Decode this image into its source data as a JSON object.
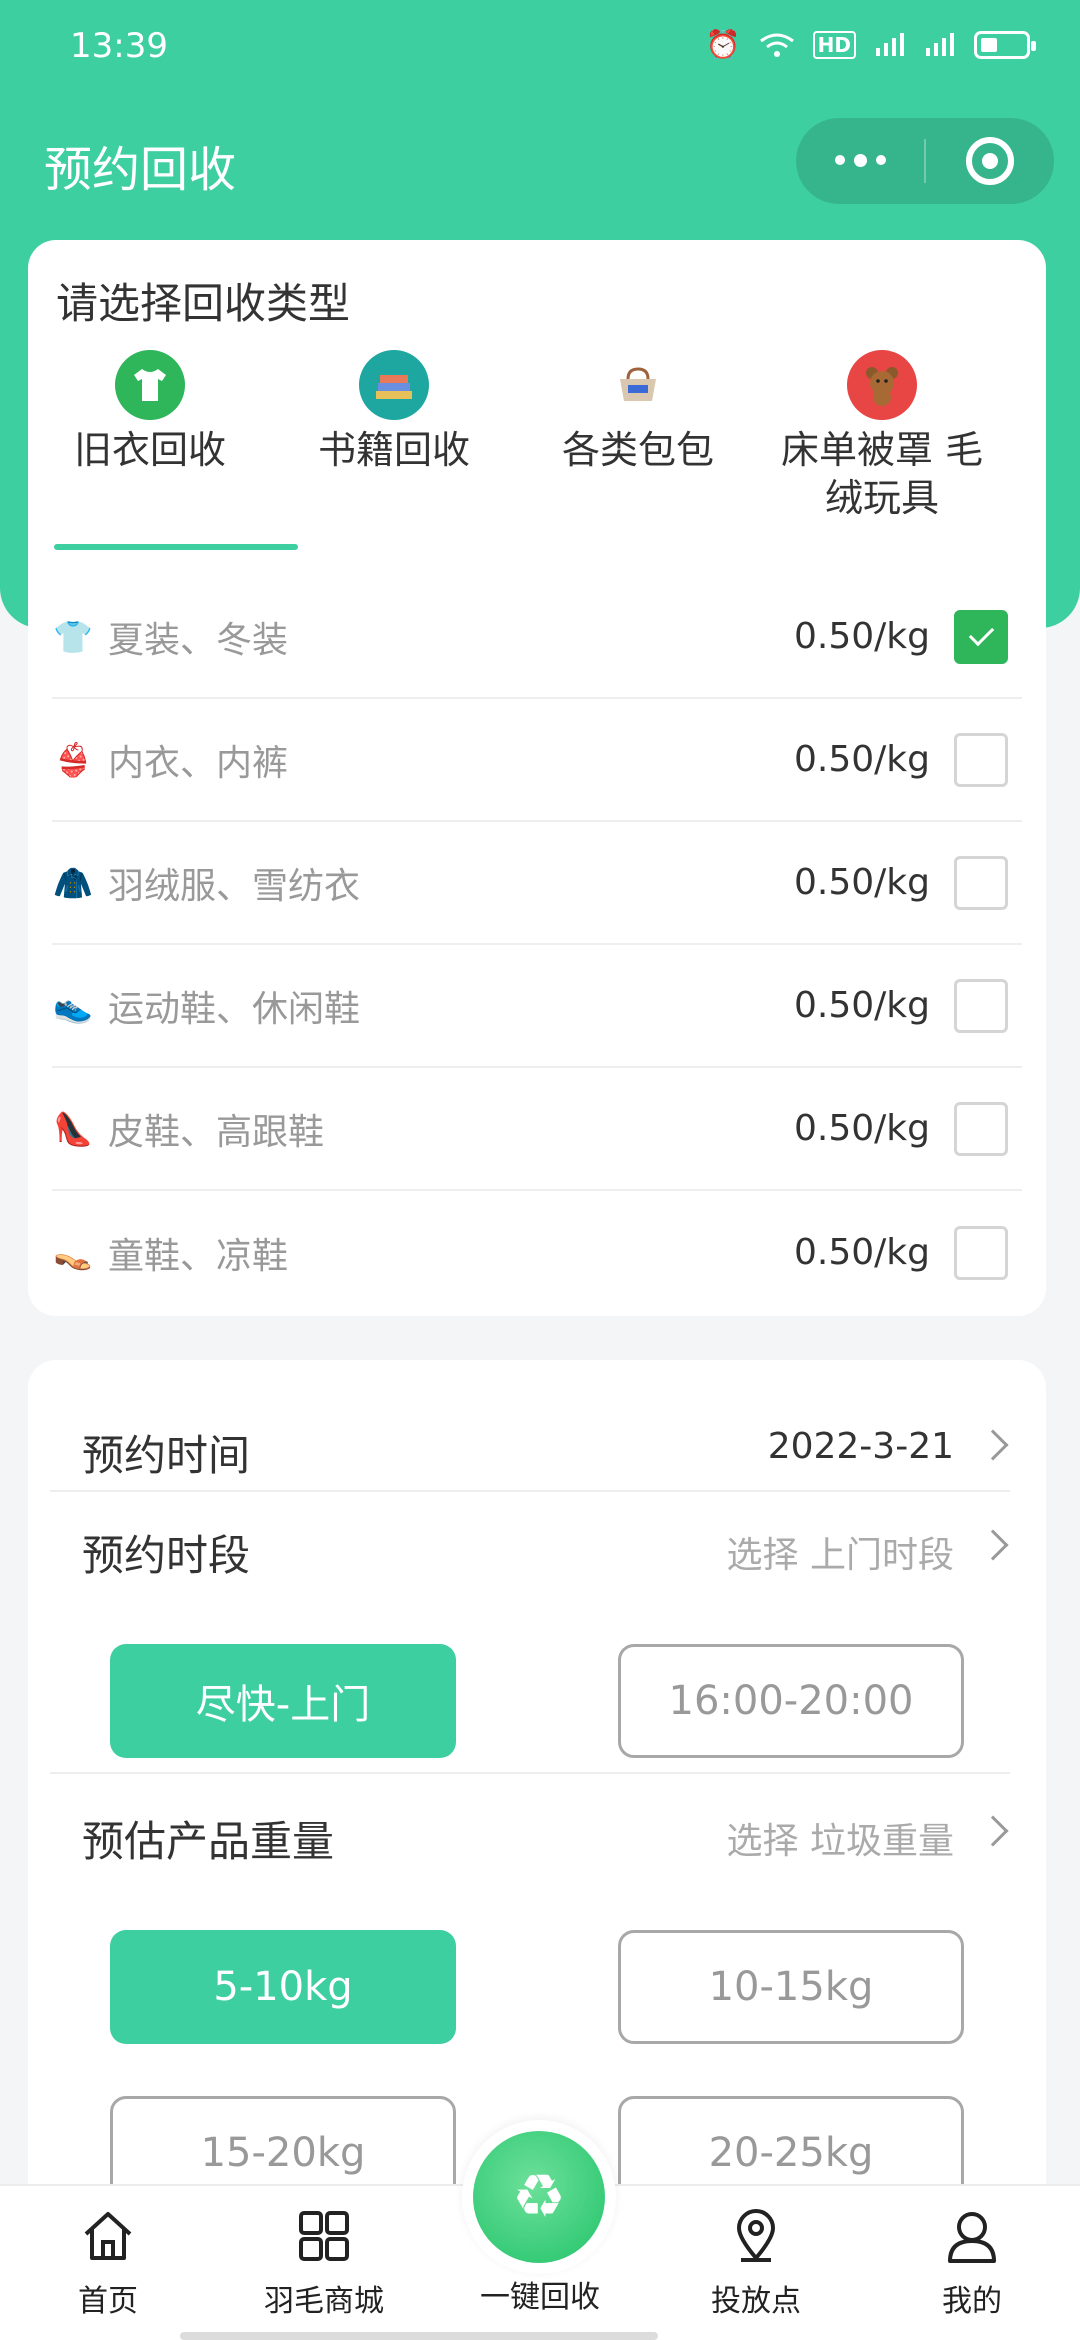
{
  "status_bar": {
    "time": "13:39",
    "icons": [
      "alarm-icon",
      "wifi-icon",
      "hd-icon",
      "signal-4g-icon",
      "signal-4g-icon",
      "battery-icon"
    ]
  },
  "nav": {
    "title": "预约回收",
    "capsule_icons": [
      "more-icon",
      "target-icon"
    ]
  },
  "category_section": {
    "title": "请选择回收类型",
    "tabs": [
      {
        "label": "旧衣回收",
        "icon": "tshirt-icon",
        "icon_color": "#2fb55a",
        "active": true
      },
      {
        "label": "书籍回收",
        "icon": "books-icon",
        "icon_color": "#1ea7a0",
        "active": false
      },
      {
        "label": "各类包包",
        "icon": "bag-icon",
        "icon_color": "#ffffff",
        "active": false
      },
      {
        "label": "床单被罩 毛绒玩具",
        "icon": "teddy-bear-icon",
        "icon_color": "#e84545",
        "active": false
      }
    ],
    "items": [
      {
        "name": "夏装、冬装",
        "price": "0.50/kg",
        "checked": true,
        "thumb": "clothes-icon"
      },
      {
        "name": "内衣、内裤",
        "price": "0.50/kg",
        "checked": false,
        "thumb": "underwear-icon"
      },
      {
        "name": "羽绒服、雪纺衣",
        "price": "0.50/kg",
        "checked": false,
        "thumb": "coat-icon"
      },
      {
        "name": "运动鞋、休闲鞋",
        "price": "0.50/kg",
        "checked": false,
        "thumb": "sneaker-icon"
      },
      {
        "name": "皮鞋、高跟鞋",
        "price": "0.50/kg",
        "checked": false,
        "thumb": "heels-icon"
      },
      {
        "name": "童鞋、凉鞋",
        "price": "0.50/kg",
        "checked": false,
        "thumb": "sandal-icon"
      }
    ]
  },
  "schedule": {
    "date_label": "预约时间",
    "date_value": "2022-3-21",
    "period_label": "预约时段",
    "period_hint": "选择 上门时段",
    "period_options": [
      {
        "label": "尽快-上门",
        "selected": true
      },
      {
        "label": "16:00-20:00",
        "selected": false
      }
    ],
    "weight_label": "预估产品重量",
    "weight_hint": "选择 垃圾重量",
    "weight_options": [
      {
        "label": "5-10kg",
        "selected": true
      },
      {
        "label": "10-15kg",
        "selected": false
      },
      {
        "label": "15-20kg",
        "selected": false
      },
      {
        "label": "20-25kg",
        "selected": false
      }
    ]
  },
  "tabbar": {
    "items": [
      {
        "label": "首页",
        "icon": "home-icon"
      },
      {
        "label": "羽毛商城",
        "icon": "grid-icon"
      },
      {
        "label": "一键回收",
        "icon": "recycle-icon"
      },
      {
        "label": "投放点",
        "icon": "location-pin-icon"
      },
      {
        "label": "我的",
        "icon": "user-icon"
      }
    ]
  },
  "colors": {
    "primary": "#3ecfa0",
    "check_green": "#2fb55a",
    "muted_text": "#999999"
  }
}
